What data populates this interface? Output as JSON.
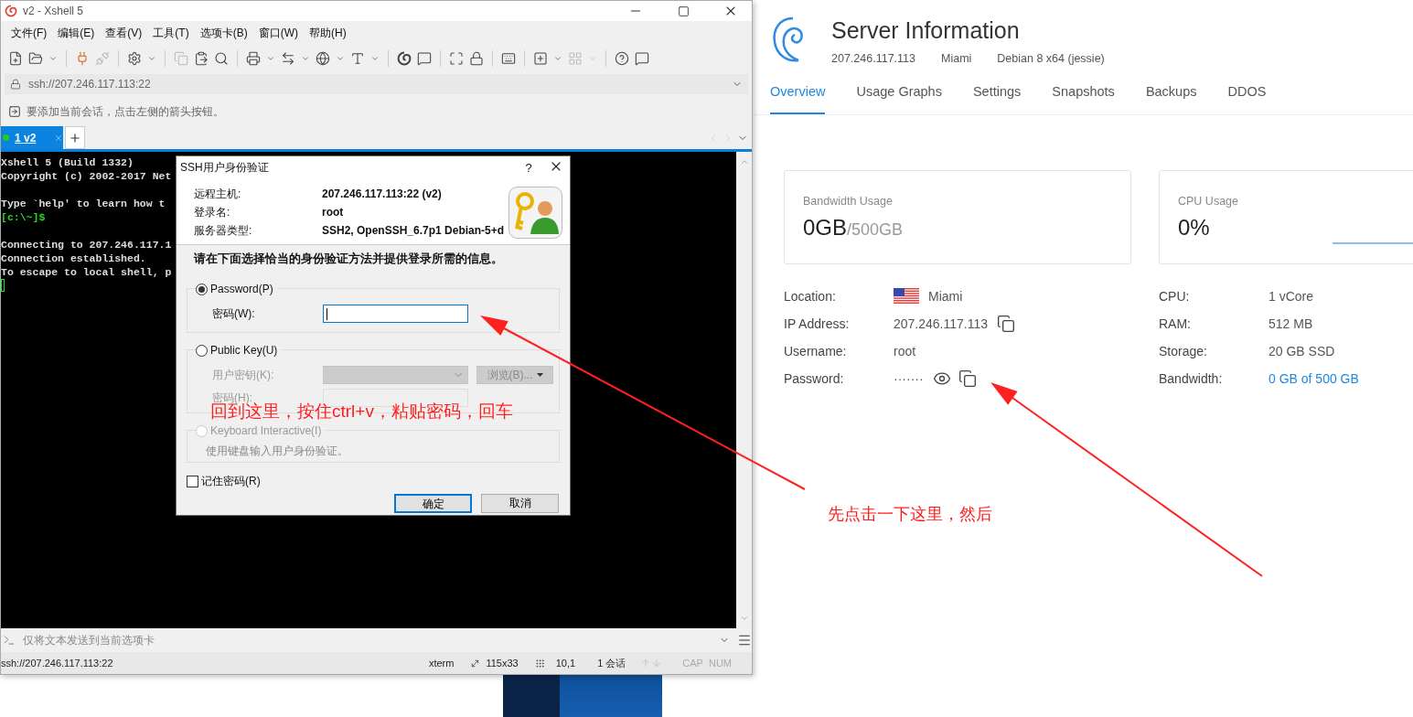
{
  "xshell": {
    "title": "v2 - Xshell 5",
    "menu": [
      "文件(F)",
      "编辑(E)",
      "查看(V)",
      "工具(T)",
      "选项卡(B)",
      "窗口(W)",
      "帮助(H)"
    ],
    "address": "ssh://207.246.117.113:22",
    "hint": "要添加当前会话，点击左侧的箭头按钮。",
    "tabs": [
      {
        "label": "1 v2",
        "selected": true,
        "connected": true
      }
    ],
    "terminal_lines": [
      {
        "kind": "output",
        "text": "Xshell 5 (Build 1332)"
      },
      {
        "kind": "output",
        "text": "Copyright (c) 2002-2017 Net"
      },
      {
        "kind": "blank"
      },
      {
        "kind": "output",
        "text": "Type `help' to learn how t"
      },
      {
        "kind": "prompt",
        "text": "[c:\\~]$"
      },
      {
        "kind": "blank"
      },
      {
        "kind": "output",
        "text": "Connecting to 207.246.117.1"
      },
      {
        "kind": "output",
        "text": "Connection established."
      },
      {
        "kind": "output",
        "text": "To escape to local shell, p"
      },
      {
        "kind": "cursor"
      }
    ],
    "compose_placeholder": "仅将文本发送到当前选项卡",
    "status_bar": {
      "address": "ssh://207.246.117.113:22",
      "terminal": "xterm",
      "size": "115x33",
      "cursor": "10,1",
      "sessions": "1 会话",
      "locks": [
        {
          "label": "CAP",
          "on": false
        },
        {
          "label": "NUM",
          "on": false
        }
      ]
    }
  },
  "dialog": {
    "title": "SSH用户身份验证",
    "help": "?",
    "info": [
      {
        "label": "远程主机:",
        "value": "207.246.117.113:22 (v2)"
      },
      {
        "label": "登录名:",
        "value": "root"
      },
      {
        "label": "服务器类型:",
        "value": "SSH2, OpenSSH_6.7p1 Debian-5+d"
      }
    ],
    "instruction": "请在下面选择恰当的身份验证方法并提供登录所需的信息。",
    "methods": [
      {
        "label": "Password(P)",
        "selected": true,
        "disabled": false,
        "fields": [
          {
            "kind": "input",
            "label": "密码(W):",
            "disabled": false,
            "focused": true
          }
        ]
      },
      {
        "label": "Public Key(U)",
        "selected": false,
        "disabled": false,
        "fields": [
          {
            "kind": "select",
            "label": "用户密钥(K):",
            "disabled": true,
            "button": "浏览(B)..."
          },
          {
            "kind": "input",
            "label": "密码(H):",
            "disabled": true,
            "focused": false
          }
        ]
      },
      {
        "label": "Keyboard Interactive(I)",
        "selected": false,
        "disabled": true,
        "description": "使用键盘输入用户身份验证。"
      }
    ],
    "remember": {
      "label": "记住密码(R)",
      "checked": false
    },
    "buttons": [
      {
        "label": "确定",
        "default": true
      },
      {
        "label": "取消",
        "default": false
      }
    ]
  },
  "annotations": [
    "回到这里，按住ctrl+v，粘贴密码，回车",
    "先点击一下这里，然后"
  ],
  "server": {
    "title": "Server Information",
    "meta": [
      "207.246.117.113",
      "Miami",
      "Debian 8 x64 (jessie)"
    ],
    "tabs": [
      {
        "label": "Overview",
        "selected": true
      },
      {
        "label": "Usage Graphs",
        "selected": false
      },
      {
        "label": "Settings",
        "selected": false
      },
      {
        "label": "Snapshots",
        "selected": false
      },
      {
        "label": "Backups",
        "selected": false
      },
      {
        "label": "DDOS",
        "selected": false
      }
    ],
    "cards": [
      {
        "kind": "total",
        "label": "Bandwidth Usage",
        "value": "0GB",
        "unit": "/500GB"
      },
      {
        "kind": "graph",
        "label": "CPU Usage",
        "value": "0%"
      }
    ],
    "details_left": [
      {
        "kind": "flag",
        "label": "Location:",
        "value": "Miami"
      },
      {
        "kind": "copy",
        "label": "IP Address:",
        "value": "207.246.117.113"
      },
      {
        "kind": "plain",
        "label": "Username:",
        "value": "root"
      },
      {
        "kind": "secret",
        "label": "Password:",
        "value": "·······"
      }
    ],
    "details_right": [
      {
        "kind": "plain",
        "label": "CPU:",
        "value": "1 vCore"
      },
      {
        "kind": "plain",
        "label": "RAM:",
        "value": "512 MB"
      },
      {
        "kind": "plain",
        "label": "Storage:",
        "value": "20 GB SSD"
      },
      {
        "kind": "link",
        "label": "Bandwidth:",
        "value": "0 GB of 500 GB"
      }
    ]
  }
}
